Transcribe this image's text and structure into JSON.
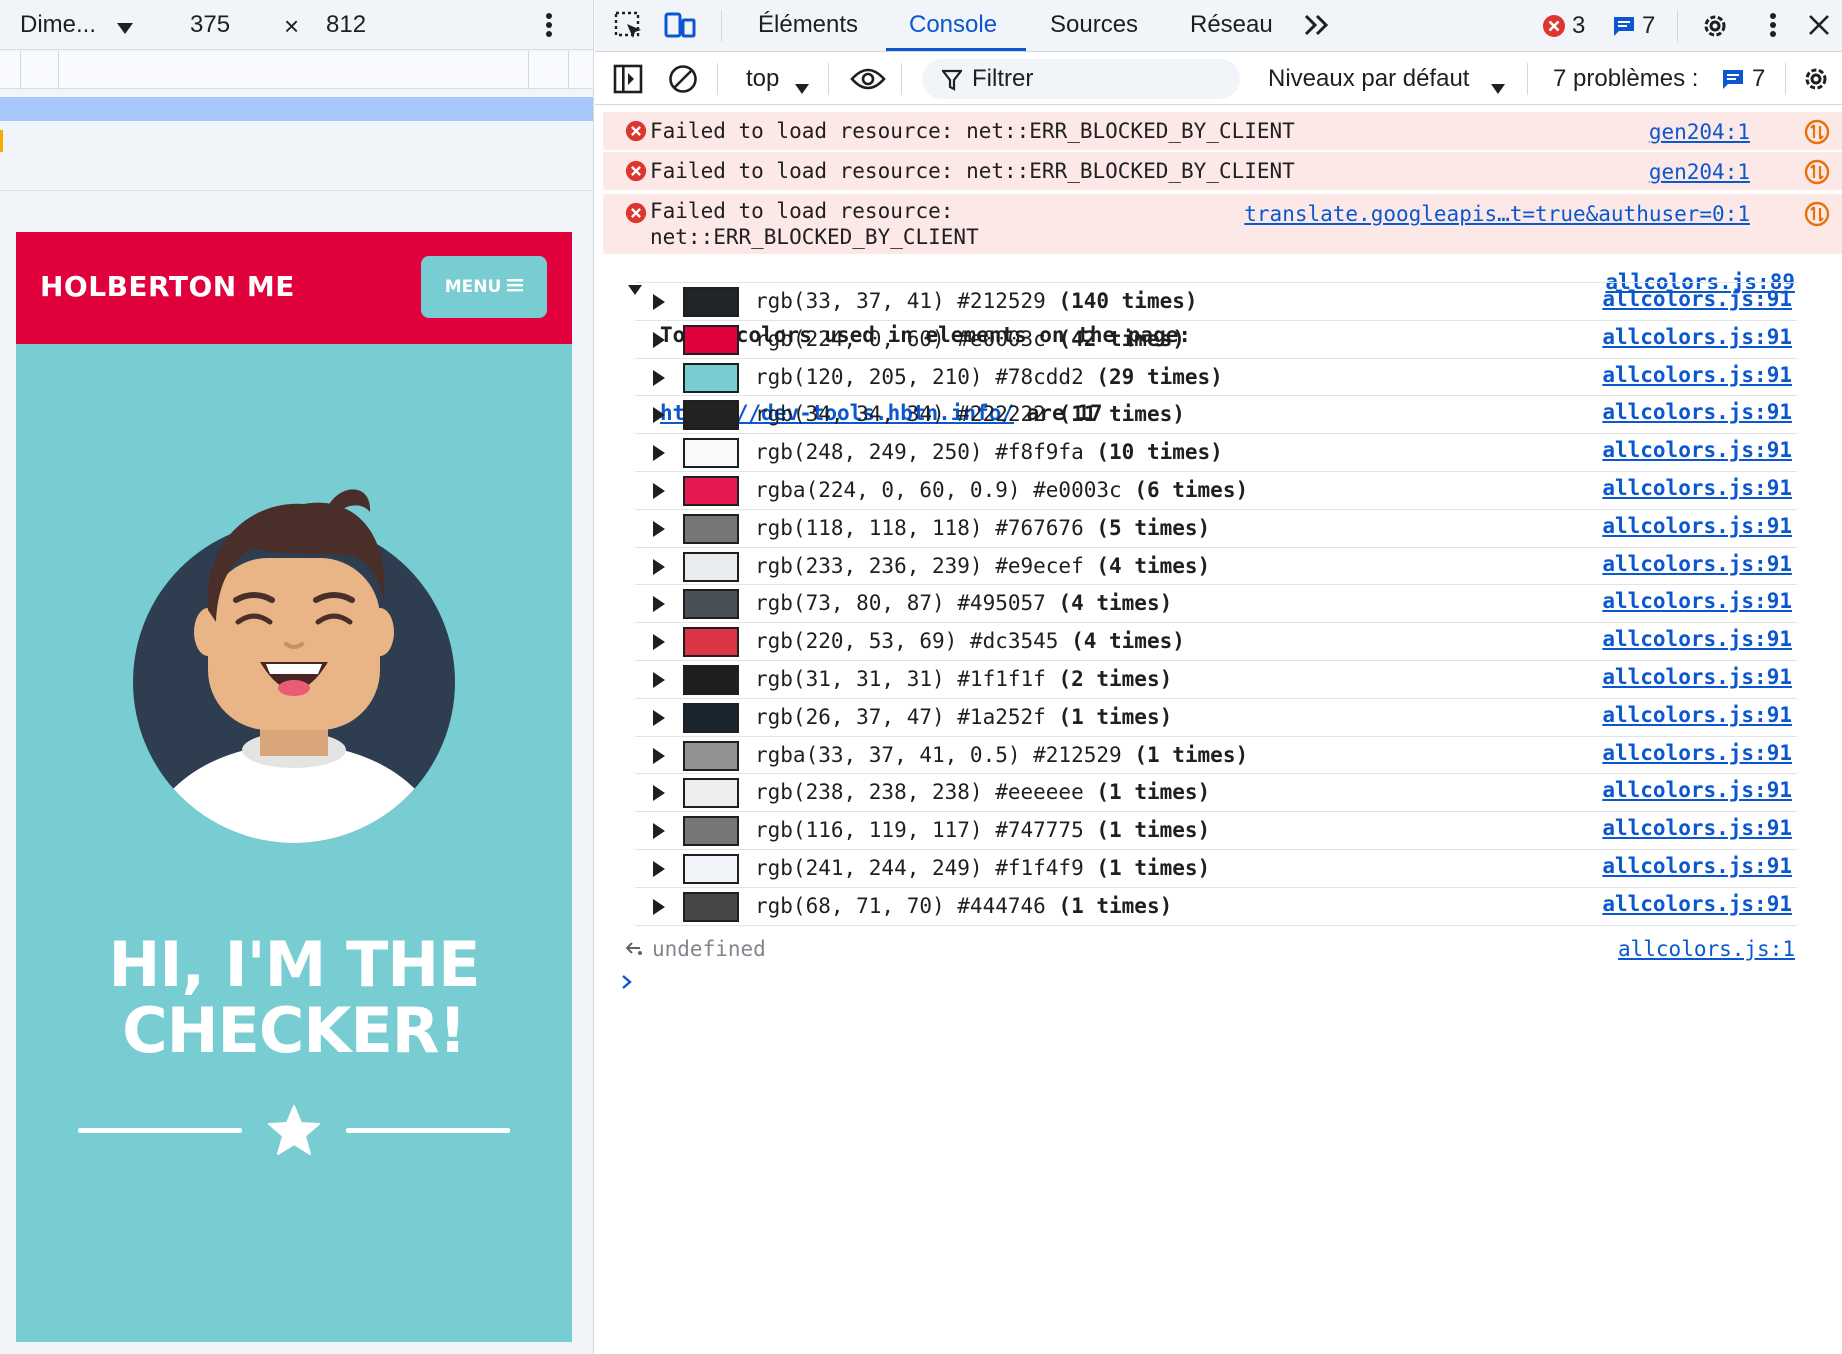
{
  "device_toolbar": {
    "device": "Dime...",
    "width": "375",
    "times": "×",
    "height": "812"
  },
  "site": {
    "brand": "HOLBERTON ME",
    "menu_label": "MENU",
    "hero_line1": "HI, I'M THE",
    "hero_line2": "CHECKER!"
  },
  "devtools": {
    "tabs": [
      "Éléments",
      "Console",
      "Sources",
      "Réseau"
    ],
    "active_tab": "Console",
    "error_count": "3",
    "message_count": "7",
    "toolbar": {
      "context": "top",
      "filter_placeholder": "Filtrer",
      "levels": "Niveaux par défaut",
      "issues_label": "7 problèmes :",
      "issues_count": "7"
    }
  },
  "console": {
    "errors": [
      {
        "message": "Failed to load resource: net::ERR_BLOCKED_BY_CLIENT",
        "source": "gen204:1"
      },
      {
        "message": "Failed to load resource: net::ERR_BLOCKED_BY_CLIENT",
        "source": "gen204:1"
      },
      {
        "message_line1": "Failed to load resource:",
        "message_line2": "net::ERR_BLOCKED_BY_CLIENT",
        "source": "translate.googleapis…t=true&authuser=0:1"
      }
    ],
    "group": {
      "line1": "Total colors used in elements on the page:",
      "link": "https://dev-tools.hbtn.info/",
      "line2_suffix": " are 17",
      "source": "allcolors.js:89"
    },
    "colors": [
      {
        "value": "rgb(33, 37, 41) #212529",
        "count": "(140 times)",
        "hex": "#212529",
        "source": "allcolors.js:91"
      },
      {
        "value": "rgb(224, 0, 60) #e0003c",
        "count": "(42 times)",
        "hex": "#e0003c",
        "source": "allcolors.js:91"
      },
      {
        "value": "rgb(120, 205, 210) #78cdd2",
        "count": "(29 times)",
        "hex": "#78cdd2",
        "source": "allcolors.js:91"
      },
      {
        "value": "rgb(34, 34, 34) #222222",
        "count": "(11 times)",
        "hex": "#222222",
        "source": "allcolors.js:91"
      },
      {
        "value": "rgb(248, 249, 250) #f8f9fa",
        "count": "(10 times)",
        "hex": "#f8f9fa",
        "source": "allcolors.js:91"
      },
      {
        "value": "rgba(224, 0, 60, 0.9) #e0003c",
        "count": "(6 times)",
        "hex": "#e41a50",
        "source": "allcolors.js:91"
      },
      {
        "value": "rgb(118, 118, 118) #767676",
        "count": "(5 times)",
        "hex": "#767676",
        "source": "allcolors.js:91"
      },
      {
        "value": "rgb(233, 236, 239) #e9ecef",
        "count": "(4 times)",
        "hex": "#e9ecef",
        "source": "allcolors.js:91"
      },
      {
        "value": "rgb(73, 80, 87) #495057",
        "count": "(4 times)",
        "hex": "#495057",
        "source": "allcolors.js:91"
      },
      {
        "value": "rgb(220, 53, 69) #dc3545",
        "count": "(4 times)",
        "hex": "#dc3545",
        "source": "allcolors.js:91"
      },
      {
        "value": "rgb(31, 31, 31) #1f1f1f",
        "count": "(2 times)",
        "hex": "#1f1f1f",
        "source": "allcolors.js:91"
      },
      {
        "value": "rgb(26, 37, 47) #1a252f",
        "count": "(1 times)",
        "hex": "#1a252f",
        "source": "allcolors.js:91"
      },
      {
        "value": "rgba(33, 37, 41, 0.5) #212529",
        "count": "(1 times)",
        "hex": "#909294",
        "source": "allcolors.js:91"
      },
      {
        "value": "rgb(238, 238, 238) #eeeeee",
        "count": "(1 times)",
        "hex": "#eeeeee",
        "source": "allcolors.js:91"
      },
      {
        "value": "rgb(116, 119, 117) #747775",
        "count": "(1 times)",
        "hex": "#747775",
        "source": "allcolors.js:91"
      },
      {
        "value": "rgb(241, 244, 249) #f1f4f9",
        "count": "(1 times)",
        "hex": "#f1f4f9",
        "source": "allcolors.js:91"
      },
      {
        "value": "rgb(68, 71, 70) #444746",
        "count": "(1 times)",
        "hex": "#444746",
        "source": "allcolors.js:91"
      }
    ],
    "result": {
      "value": "undefined",
      "source": "allcolors.js:1"
    }
  },
  "theme": {
    "accent": "#0b57d0",
    "brand_red": "#e0003c",
    "brand_teal": "#78cdd2",
    "error_bg": "#fce8e6"
  }
}
